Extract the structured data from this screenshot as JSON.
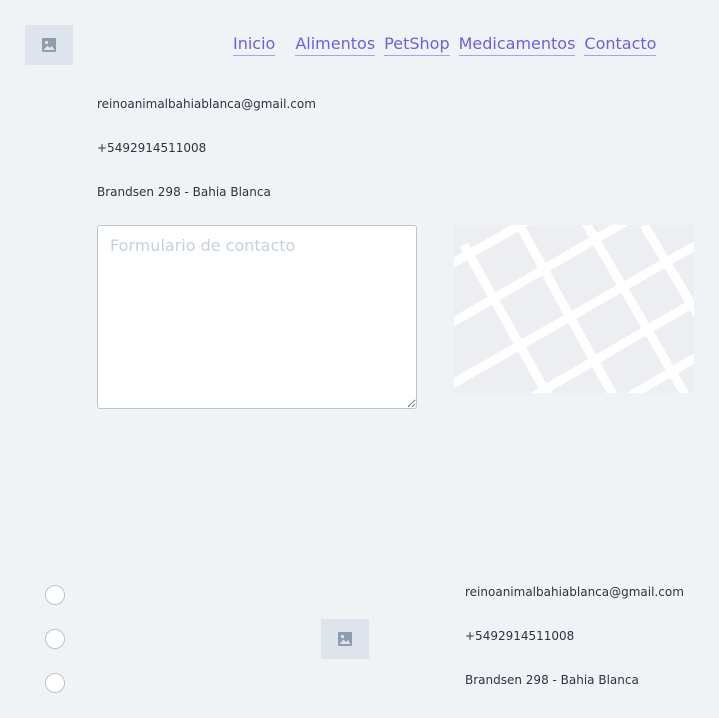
{
  "header": {
    "logo_icon": "image-placeholder-icon",
    "nav": [
      "Inicio",
      "Alimentos",
      "PetShop",
      "Medicamentos",
      "Contacto"
    ]
  },
  "contact": {
    "email": "reinoanimalbahiablanca@gmail.com",
    "phone": "+5492914511008",
    "address": "Brandsen 298 - Bahia Blanca"
  },
  "form": {
    "placeholder": "Formulario de contacto"
  },
  "map": {
    "icon": "map-icon"
  },
  "footer": {
    "logo_icon": "image-placeholder-icon",
    "email": "reinoanimalbahiablanca@gmail.com",
    "phone": "+5492914511008",
    "address": "Brandsen 298 - Bahia Blanca",
    "radio_count": 3
  },
  "colors": {
    "background": "#eff3f6",
    "link": "#6a62d8",
    "placeholder_box": "#dde4ec"
  }
}
